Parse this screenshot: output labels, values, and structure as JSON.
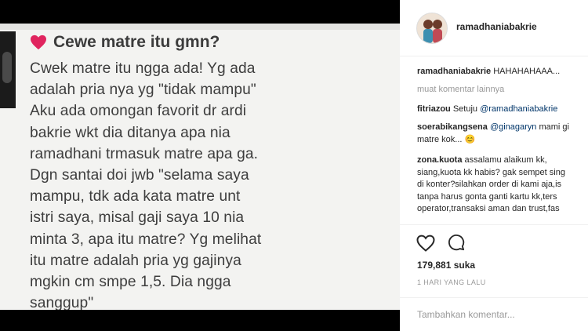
{
  "post": {
    "question_title": "Cewe matre itu gmn?",
    "answer_lines": [
      "Cwek matre itu ngga ada! Yg ada",
      "adalah pria nya yg \"tidak mampu\"",
      "Aku ada omongan favorit dr ardi",
      "bakrie wkt dia ditanya apa nia",
      "ramadhani trmasuk matre apa ga.",
      "Dgn santai doi jwb \"selama saya",
      "mampu, tdk ada kata matre unt",
      "istri saya, misal gaji saya 10 nia",
      "minta 3, apa itu matre? Yg melihat",
      "itu matre adalah pria yg gajinya",
      "mgkin cm smpe 1,5. Dia ngga",
      "sanggup\""
    ],
    "colors": {
      "heart": "#e0245e",
      "text": "#3d3d3d"
    }
  },
  "header": {
    "username": "ramadhaniabakrie"
  },
  "comments": {
    "caption": {
      "user": "ramadhaniabakrie",
      "text": "HAHAHAHAAA..."
    },
    "load_more": "muat komentar lainnya",
    "items": [
      {
        "user": "fitriazou",
        "text": "Setuju ",
        "mention": "@ramadhaniabakrie"
      },
      {
        "user": "soerabikangsena",
        "mention": "@ginagaryn",
        "text": " mami gi",
        "line2": "matre kok... 😊"
      },
      {
        "user": "zona.kuota",
        "lines": [
          "assalamu alaikum kk,",
          "siang,kuota kk habis? gak sempet sing",
          "di konter?silahkan order di kami aja,is",
          "tanpa harus gonta ganti kartu kk,ters",
          "operator,transaksi aman dan trust,fas"
        ]
      }
    ]
  },
  "actions": {
    "like_icon": "heart-outline-icon",
    "comment_icon": "speech-bubble-icon",
    "likes": "179,881 suka",
    "time": "1 HARI YANG LALU",
    "add_comment_placeholder": "Tambahkan komentar..."
  }
}
